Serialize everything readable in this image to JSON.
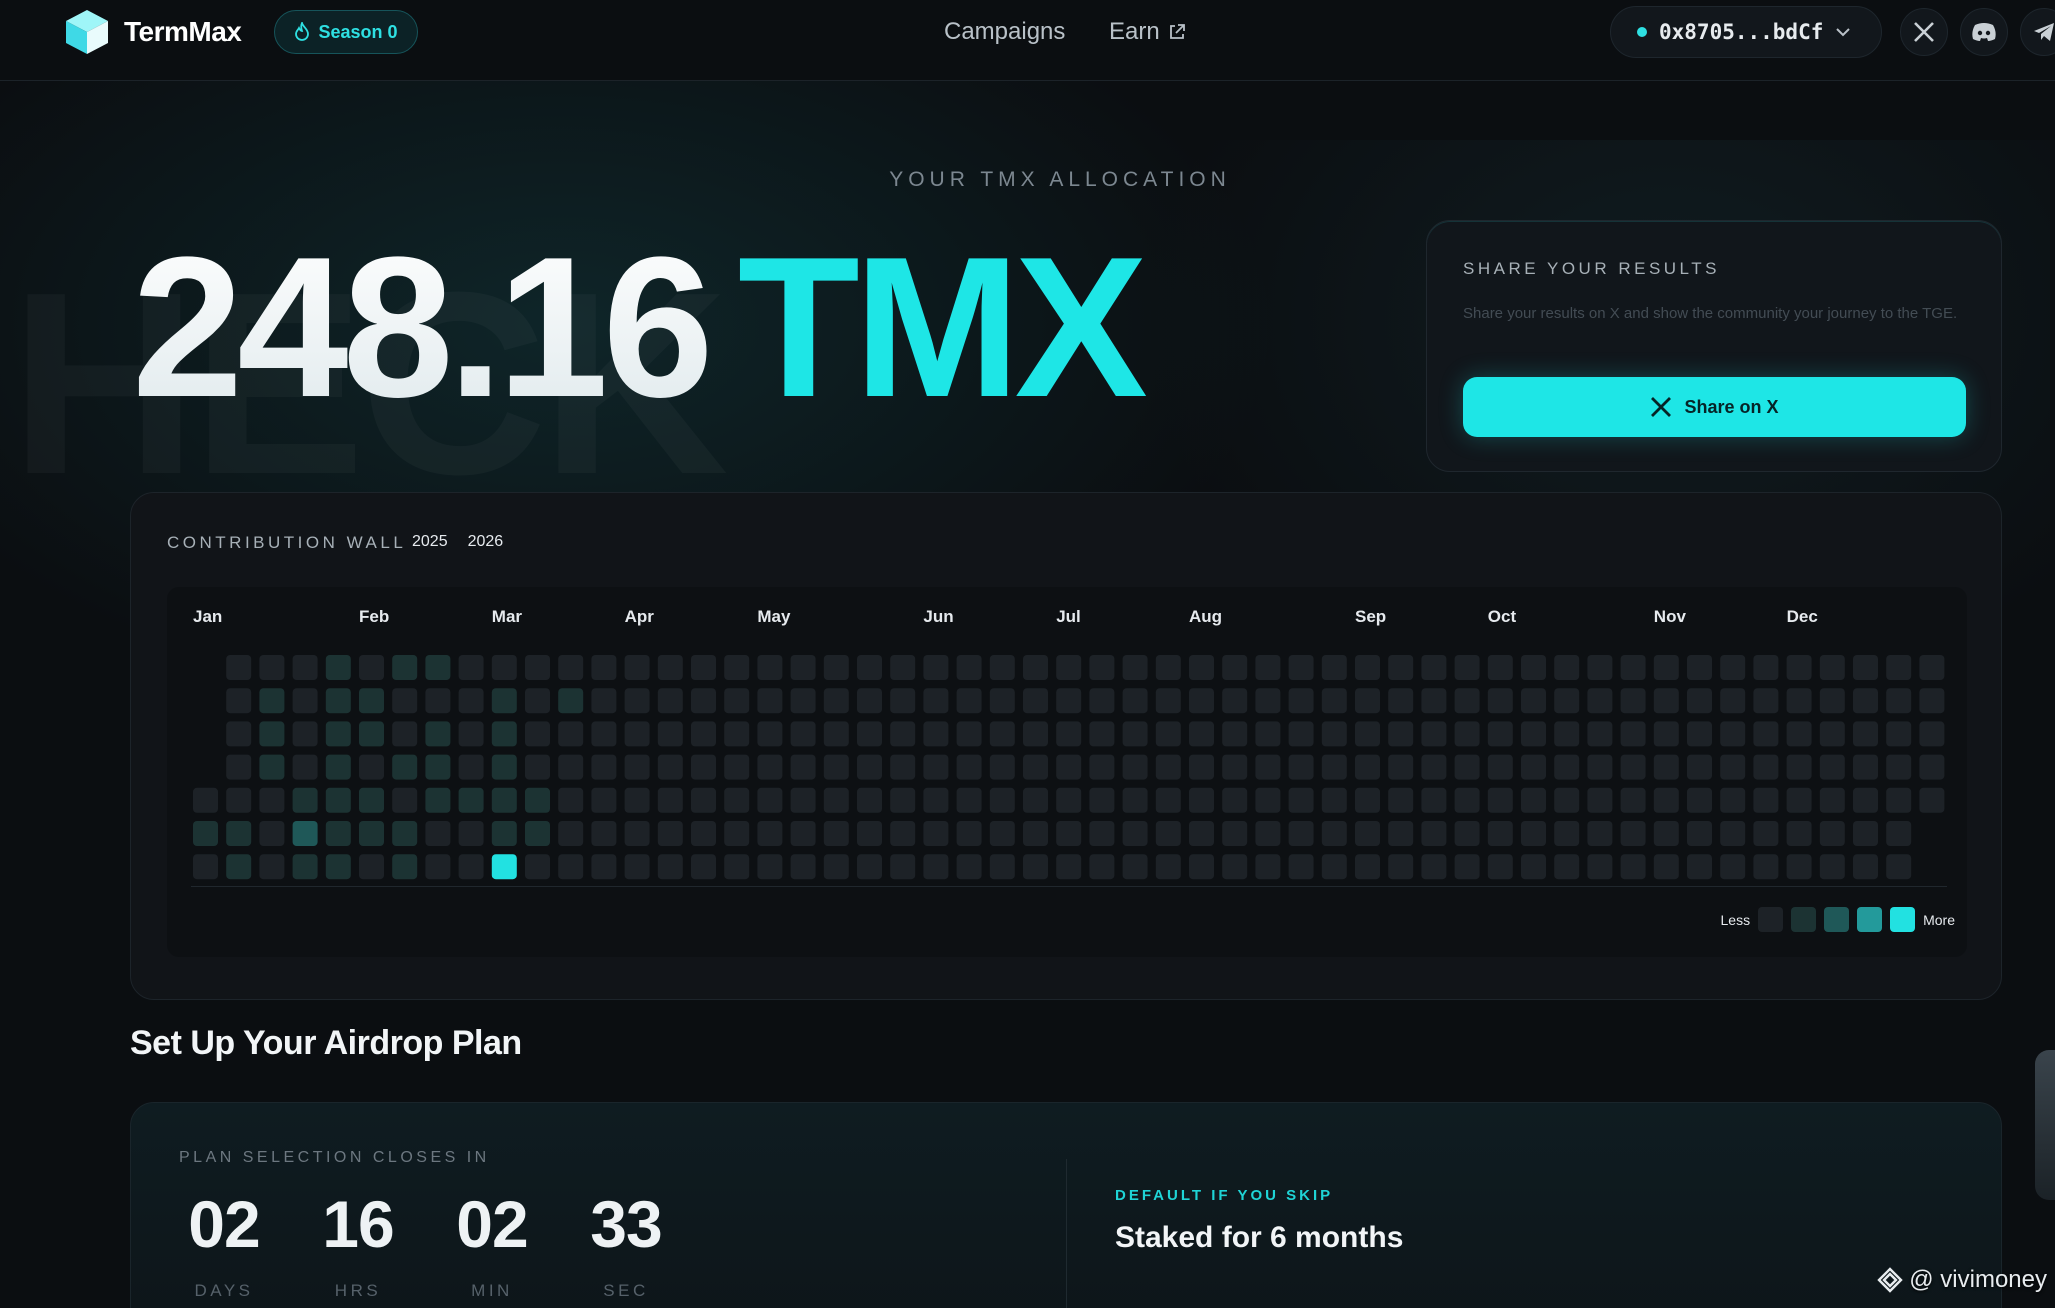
{
  "header": {
    "logo_text": "TermMax",
    "season_label": "Season 0",
    "nav": [
      {
        "label": "Campaigns"
      },
      {
        "label": "Earn"
      }
    ],
    "wallet_address": "0x8705...bdCf"
  },
  "background_word": "HECK",
  "allocation": {
    "label": "YOUR TMX ALLOCATION",
    "amount": "248.16",
    "unit": "TMX"
  },
  "share": {
    "title": "SHARE YOUR RESULTS",
    "description": "Share your results on X and show the community your journey to the TGE.",
    "button_label": "Share on X"
  },
  "contribution_wall": {
    "title": "CONTRIBUTION WALL",
    "years": [
      "2025",
      "2026"
    ],
    "months": [
      "Jan",
      "Feb",
      "Mar",
      "Apr",
      "May",
      "Jun",
      "Jul",
      "Aug",
      "Sep",
      "Oct",
      "Nov",
      "Dec"
    ],
    "legend_less": "Less",
    "legend_more": "More",
    "level_colors": [
      "#1d2227",
      "#1c3333",
      "#1f5858",
      "#239a9b",
      "#22e1e1"
    ],
    "active_days": [
      {
        "week": 4,
        "day": 0,
        "level": 1
      },
      {
        "week": 6,
        "day": 0,
        "level": 1
      },
      {
        "week": 7,
        "day": 0,
        "level": 1
      },
      {
        "week": 2,
        "day": 1,
        "level": 1
      },
      {
        "week": 4,
        "day": 1,
        "level": 1
      },
      {
        "week": 5,
        "day": 1,
        "level": 1
      },
      {
        "week": 9,
        "day": 1,
        "level": 1
      },
      {
        "week": 11,
        "day": 1,
        "level": 1
      },
      {
        "week": 2,
        "day": 2,
        "level": 1
      },
      {
        "week": 4,
        "day": 2,
        "level": 1
      },
      {
        "week": 5,
        "day": 2,
        "level": 1
      },
      {
        "week": 7,
        "day": 2,
        "level": 1
      },
      {
        "week": 9,
        "day": 2,
        "level": 1
      },
      {
        "week": 2,
        "day": 3,
        "level": 1
      },
      {
        "week": 4,
        "day": 3,
        "level": 1
      },
      {
        "week": 6,
        "day": 3,
        "level": 1
      },
      {
        "week": 7,
        "day": 3,
        "level": 1
      },
      {
        "week": 9,
        "day": 3,
        "level": 1
      },
      {
        "week": 3,
        "day": 4,
        "level": 1
      },
      {
        "week": 4,
        "day": 4,
        "level": 1
      },
      {
        "week": 5,
        "day": 4,
        "level": 1
      },
      {
        "week": 7,
        "day": 4,
        "level": 1
      },
      {
        "week": 8,
        "day": 4,
        "level": 1
      },
      {
        "week": 9,
        "day": 4,
        "level": 1
      },
      {
        "week": 10,
        "day": 4,
        "level": 1
      },
      {
        "week": 0,
        "day": 5,
        "level": 1
      },
      {
        "week": 1,
        "day": 5,
        "level": 1
      },
      {
        "week": 3,
        "day": 5,
        "level": 2
      },
      {
        "week": 4,
        "day": 5,
        "level": 1
      },
      {
        "week": 5,
        "day": 5,
        "level": 1
      },
      {
        "week": 6,
        "day": 5,
        "level": 1
      },
      {
        "week": 9,
        "day": 5,
        "level": 1
      },
      {
        "week": 10,
        "day": 5,
        "level": 1
      },
      {
        "week": 1,
        "day": 6,
        "level": 1
      },
      {
        "week": 3,
        "day": 6,
        "level": 1
      },
      {
        "week": 4,
        "day": 6,
        "level": 1
      },
      {
        "week": 6,
        "day": 6,
        "level": 1
      },
      {
        "week": 9,
        "day": 6,
        "level": 4
      }
    ]
  },
  "plan": {
    "title": "Set Up Your Airdrop Plan",
    "closes_label": "PLAN SELECTION CLOSES IN",
    "countdown": [
      {
        "value": "02",
        "unit": "DAYS"
      },
      {
        "value": "16",
        "unit": "HRS"
      },
      {
        "value": "02",
        "unit": "MIN"
      },
      {
        "value": "33",
        "unit": "SEC"
      }
    ],
    "default_label": "DEFAULT IF YOU SKIP",
    "default_value": "Staked for 6 months"
  },
  "watermark": "@ vivimoney"
}
